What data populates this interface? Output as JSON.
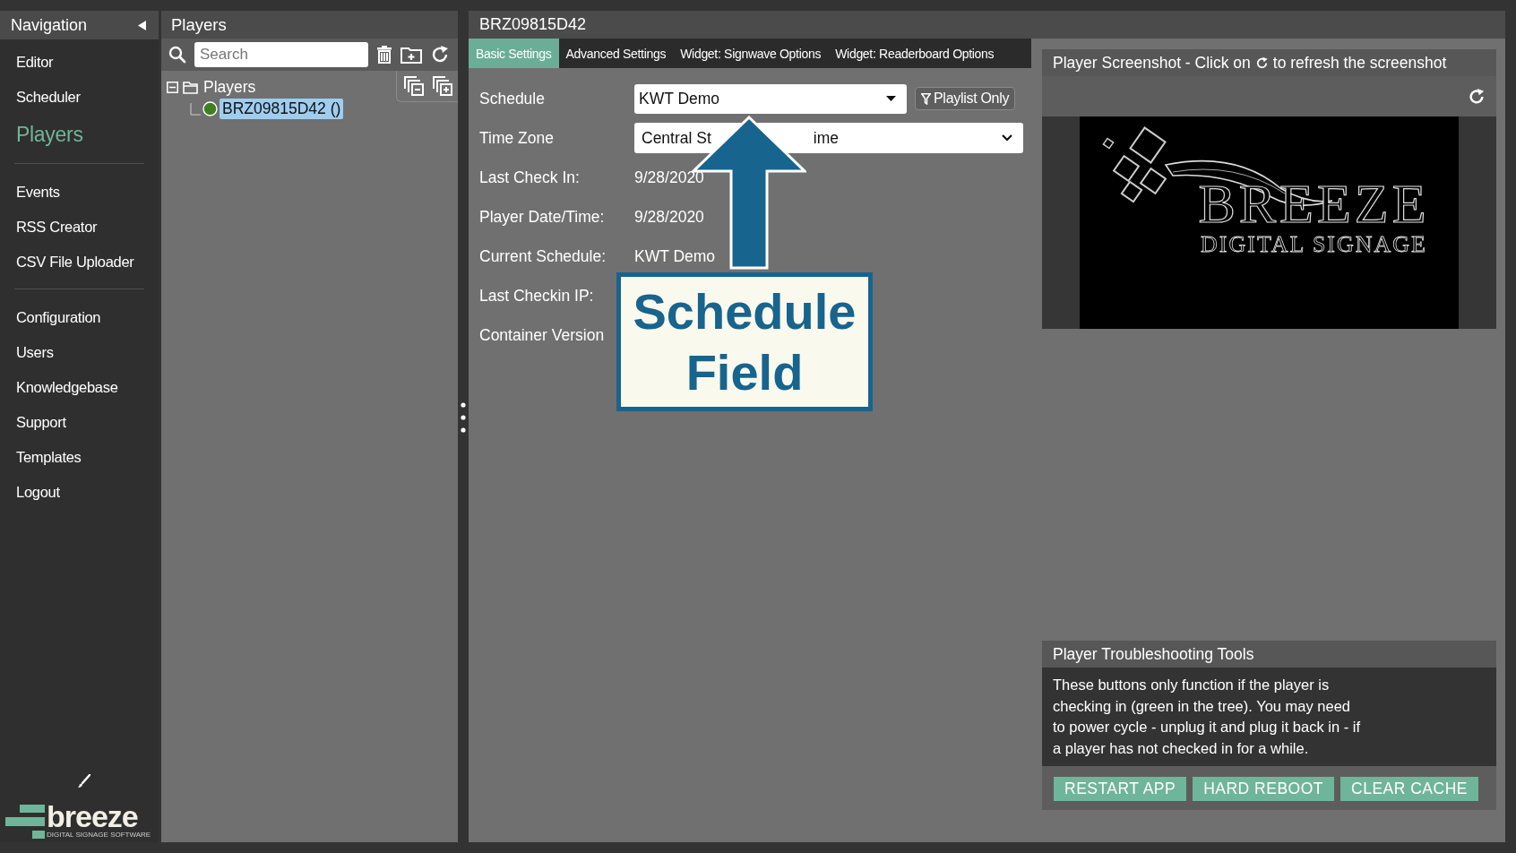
{
  "navigation": {
    "title": "Navigation",
    "sections": [
      {
        "items": [
          {
            "label": "Editor",
            "selected": false
          },
          {
            "label": "Scheduler",
            "selected": false
          },
          {
            "label": "Players",
            "selected": true
          }
        ]
      },
      {
        "items": [
          {
            "label": "Events",
            "selected": false
          },
          {
            "label": "RSS Creator",
            "selected": false
          },
          {
            "label": "CSV File Uploader",
            "selected": false
          }
        ]
      },
      {
        "items": [
          {
            "label": "Configuration",
            "selected": false
          },
          {
            "label": "Users",
            "selected": false
          },
          {
            "label": "Knowledgebase",
            "selected": false
          },
          {
            "label": "Support",
            "selected": false
          },
          {
            "label": "Templates",
            "selected": false
          },
          {
            "label": "Logout",
            "selected": false
          }
        ]
      }
    ],
    "brand": {
      "name": "breeze",
      "tagline": "DIGITAL SIGNAGE SOFTWARE"
    }
  },
  "players_panel": {
    "title": "Players",
    "search": {
      "placeholder": "Search"
    },
    "tree": [
      {
        "label": "Players",
        "expanded": true,
        "children": [
          {
            "label": "BRZ09815D42 ()",
            "selected": true,
            "color": "#3f7f1f"
          }
        ]
      }
    ]
  },
  "player": {
    "title": "BRZ09815D42",
    "tabs": [
      {
        "label": "Basic Settings",
        "selected": true
      },
      {
        "label": "Advanced Settings",
        "selected": false
      },
      {
        "label": "Widget: Signwave Options",
        "selected": false
      },
      {
        "label": "Widget: Readerboard Options",
        "selected": false
      }
    ],
    "fields": [
      {
        "kind": "dropdown",
        "label": "Schedule",
        "value": "KWT Demo",
        "filter_button": "Playlist Only"
      },
      {
        "kind": "select",
        "label": "Time Zone",
        "value_parts": [
          "Central St",
          "ime"
        ]
      },
      {
        "kind": "info",
        "label": "Last Check In:",
        "value": "9/28/2020"
      },
      {
        "kind": "info",
        "label": "Player Date/Time:",
        "value": "9/28/2020"
      },
      {
        "kind": "info",
        "label": "Current Schedule:",
        "value": "KWT Demo"
      },
      {
        "kind": "info",
        "label": "Last Checkin IP:"
      },
      {
        "kind": "info",
        "label": "Container Version"
      }
    ]
  },
  "screenshot_panel": {
    "title_parts": [
      "Player Screenshot - Click on",
      "to refresh the screenshot"
    ],
    "screen": {
      "title": "BREEZE",
      "subtitle": "DIGITAL SIGNAGE"
    }
  },
  "troubleshooting": {
    "title": "Player Troubleshooting Tools",
    "description": "These buttons only function if the player is checking in (green in the tree). You may need to power cycle - unplug it and plug it back in - if a player has not checked in for a while.",
    "buttons": [
      "RESTART APP",
      "HARD REBOOT",
      "CLEAR CACHE"
    ]
  },
  "callout": {
    "text": "Schedule Field"
  }
}
